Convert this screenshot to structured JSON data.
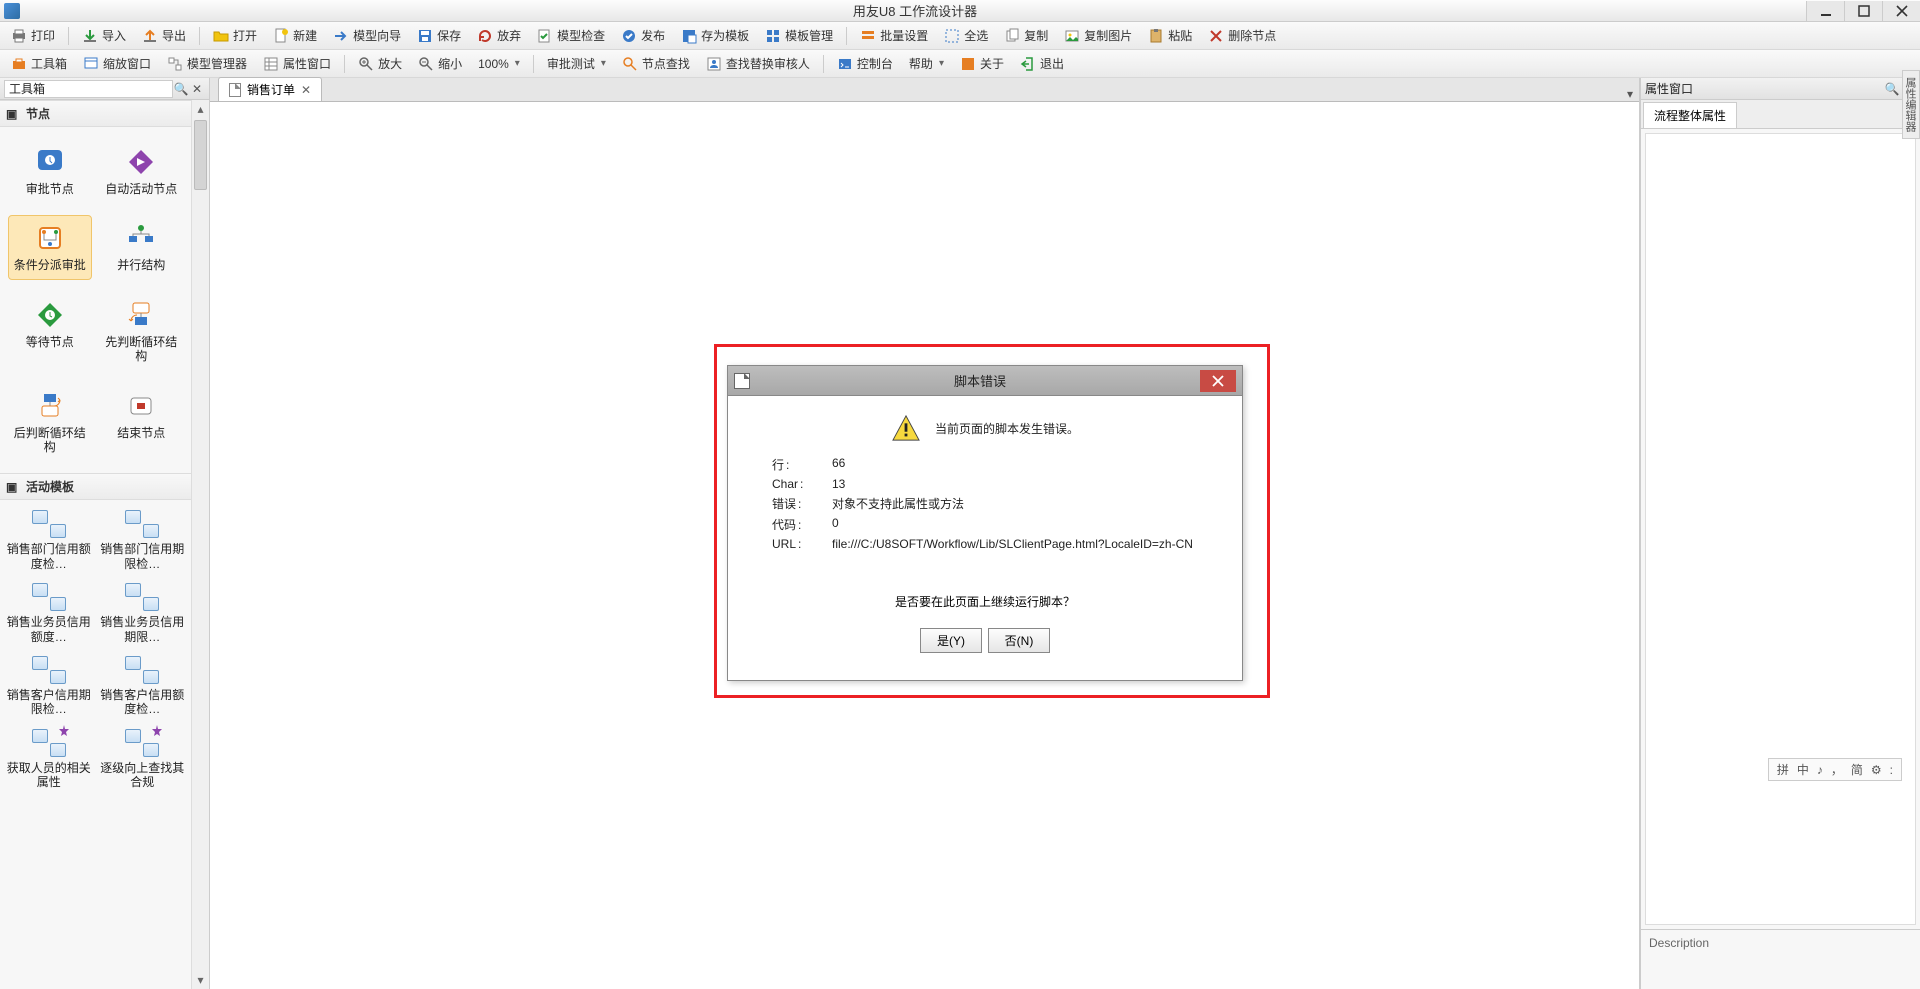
{
  "window": {
    "title": "用友U8 工作流设计器"
  },
  "toolbar1": {
    "print": "打印",
    "import": "导入",
    "export": "导出",
    "open": "打开",
    "new": "新建",
    "wizard": "模型向导",
    "save": "保存",
    "discard": "放弃",
    "check": "模型检查",
    "publish": "发布",
    "save_tpl": "存为模板",
    "tpl_mgr": "模板管理",
    "batch": "批量设置",
    "select_all": "全选",
    "copy": "复制",
    "copy_img": "复制图片",
    "paste": "粘贴",
    "del_node": "删除节点"
  },
  "toolbar2": {
    "toolbox": "工具箱",
    "zoom_win": "缩放窗口",
    "model_mgr": "模型管理器",
    "prop_win": "属性窗口",
    "zoom_in": "放大",
    "zoom_out": "缩小",
    "zoom_level": "100%",
    "test": "审批测试",
    "find_node": "节点查找",
    "replace_approver": "查找替换审核人",
    "console": "控制台",
    "help": "帮助",
    "about": "关于",
    "exit": "退出"
  },
  "left_panel": {
    "title": "工具箱",
    "section_nodes": "节点",
    "section_templates": "活动模板",
    "nodes": [
      {
        "label": "审批节点"
      },
      {
        "label": "自动活动节点"
      },
      {
        "label": "条件分派审批"
      },
      {
        "label": "并行结构"
      },
      {
        "label": "等待节点"
      },
      {
        "label": "先判断循环结构"
      },
      {
        "label": "后判断循环结构"
      },
      {
        "label": "结束节点"
      }
    ],
    "templates": [
      {
        "label": "销售部门信用额度检…"
      },
      {
        "label": "销售部门信用期限检…"
      },
      {
        "label": "销售业务员信用额度…"
      },
      {
        "label": "销售业务员信用期限…"
      },
      {
        "label": "销售客户信用期限检…"
      },
      {
        "label": "销售客户信用额度检…"
      },
      {
        "label": "获取人员的相关属性"
      },
      {
        "label": "逐级向上查找其合规"
      }
    ]
  },
  "tabs": {
    "active": "销售订单"
  },
  "right_panel": {
    "title": "属性窗口",
    "tab": "流程整体属性",
    "desc_label": "Description"
  },
  "side_tab": "属性编辑器",
  "ime": {
    "items": [
      "拼",
      "中",
      "♪",
      "，",
      "简",
      "⚙",
      ":"
    ]
  },
  "dialog": {
    "title": "脚本错误",
    "message": "当前页面的脚本发生错误。",
    "rows": {
      "line_k": "行",
      "line_v": "66",
      "char_k": "Char",
      "char_v": "13",
      "err_k": "错误",
      "err_v": "对象不支持此属性或方法",
      "code_k": "代码",
      "code_v": "0",
      "url_k": "URL",
      "url_v": "file:///C:/U8SOFT/Workflow/Lib/SLClientPage.html?LocaleID=zh-CN"
    },
    "question": "是否要在此页面上继续运行脚本？",
    "yes": "是(Y)",
    "no": "否(N)"
  }
}
